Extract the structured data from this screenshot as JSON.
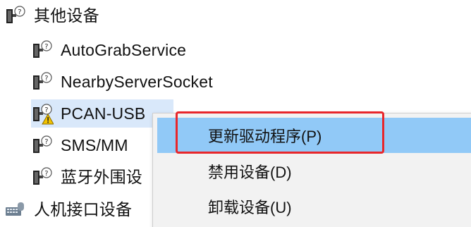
{
  "tree": {
    "category": {
      "label": "其他设备",
      "icon": "unknown-device-icon"
    },
    "children": [
      {
        "label": "AutoGrabService",
        "icon": "unknown-device-icon"
      },
      {
        "label": "NearbyServerSocket",
        "icon": "unknown-device-icon"
      },
      {
        "label": "PCAN-USB",
        "icon": "unknown-device-warning-icon",
        "selected": true
      },
      {
        "label": "SMS/MM",
        "icon": "unknown-device-icon"
      },
      {
        "label": "蓝牙外围设",
        "icon": "unknown-device-icon"
      }
    ],
    "next_category": {
      "label": "人机接口设备",
      "icon": "hid-device-icon"
    }
  },
  "context_menu": {
    "items": [
      {
        "label": "更新驱动程序(P)",
        "highlighted": true
      },
      {
        "label": "禁用设备(D)",
        "highlighted": false
      },
      {
        "label": "卸载设备(U)",
        "highlighted": false
      }
    ],
    "highlight_color": "#91c9f7",
    "annotation_border_color": "#e8262b"
  },
  "colors": {
    "selected_row_bg": "#d9e8fa",
    "menu_bg": "#f2f2f2",
    "warning": "#f2c200"
  }
}
